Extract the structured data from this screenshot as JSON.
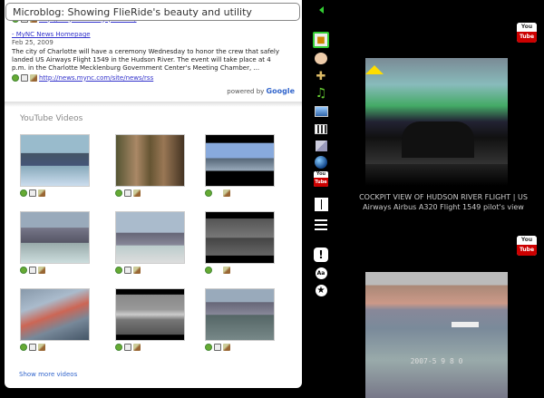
{
  "title": "Microblog: Showing FlieRide's beauty and utility",
  "news": {
    "top_link": "http://uroysarks.blogspot.com/",
    "source_link": "- MyNC News Homepage",
    "date": "Feb 25, 2009",
    "body": "The city of Charlotte will have a ceremony Wednesday to honor the crew that safely landed US Airways Flight 1549 in the Hudson River. The event will take place at 4 p.m. in the Charlotte Mecklenburg Government Center's Meeting Chamber, ...",
    "url": "http://news.mync.com/site/news/rss",
    "powered_prefix": "powered by",
    "powered_brand": "Google"
  },
  "youtube": {
    "heading": "YouTube Videos",
    "show_more": "Show more videos"
  },
  "right": {
    "caption": "COCKPIT VIEW OF HUDSON RIVER FLIGHT | US Airways Airbus A320 Flight 1549 pilot's view",
    "yt_you": "You",
    "yt_tube": "Tube",
    "timestamp": "2007-5 9 8 0"
  },
  "colors": {
    "accent_green": "#33cc33",
    "link_blue": "#3333cc",
    "youtube_red": "#cc0000"
  }
}
